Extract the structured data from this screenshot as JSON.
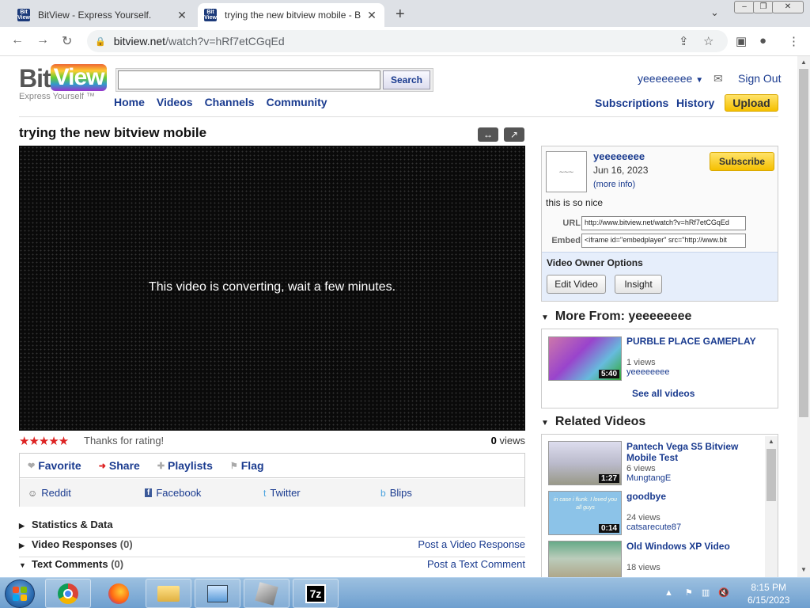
{
  "browser": {
    "tabs": [
      {
        "title": "BitView - Express Yourself.",
        "favicon": "Bit View"
      },
      {
        "title": "trying the new bitview mobile - B",
        "favicon": "Bit View"
      }
    ],
    "url_domain": "bitview.net",
    "url_path": "/watch?v=hRf7etCGqEd"
  },
  "header": {
    "logo_bit": "Bit",
    "logo_view": "View",
    "tagline": "Express Yourself ™",
    "search_placeholder": "",
    "search_button": "Search",
    "nav": [
      "Home",
      "Videos",
      "Channels",
      "Community"
    ],
    "username": "yeeeeeeee",
    "sign_out": "Sign Out",
    "subscriptions": "Subscriptions",
    "history": "History",
    "upload": "Upload"
  },
  "video": {
    "title": "trying the new bitview mobile",
    "player_message": "This video is converting, wait a few minutes.",
    "stars": "★★★★★",
    "rating_text": "Thanks for rating!",
    "view_count": "0",
    "views_label": "views",
    "actions": [
      "Favorite",
      "Share",
      "Playlists",
      "Flag"
    ],
    "share_targets": [
      "Reddit",
      "Facebook",
      "Twitter",
      "Blips"
    ]
  },
  "sections": {
    "stats": "Statistics & Data",
    "responses": "Video Responses",
    "responses_count": "(0)",
    "post_response": "Post a Video Response",
    "comments": "Text Comments",
    "comments_count": "(0)",
    "post_comment": "Post a Text Comment"
  },
  "channel": {
    "name": "yeeeeeeee",
    "date": "Jun 16, 2023",
    "more_info": "(more info)",
    "subscribe": "Subscribe",
    "description": "this is so nice",
    "url_label": "URL",
    "url_value": "http://www.bitview.net/watch?v=hRf7etCGqEd",
    "embed_label": "Embed",
    "embed_value": "<iframe id=\"embedplayer\" src=\"http://www.bit",
    "owner_options": "Video Owner Options",
    "edit_video": "Edit Video",
    "insight": "Insight"
  },
  "more_from": {
    "heading": "More From: yeeeeeeee",
    "video_title": "PURBLE PLACE GAMEPLAY",
    "duration": "5:40",
    "views": "1 views",
    "user": "yeeeeeeee",
    "see_all": "See all videos"
  },
  "related": {
    "heading": "Related Videos",
    "items": [
      {
        "title": "Pantech Vega S5 Bitview Mobile Test",
        "views": "6 views",
        "user": "MungtangE",
        "duration": "1:27"
      },
      {
        "title": "goodbye",
        "views": "24 views",
        "user": "catsarecute87",
        "duration": "0:14",
        "thumb_text": "in case i flunk. I loved you all guys"
      },
      {
        "title": "Old Windows XP Video",
        "views": "18 views",
        "user": "",
        "duration": ""
      }
    ]
  },
  "taskbar": {
    "time": "8:15 PM",
    "date": "6/15/2023",
    "app_7z": "7z"
  },
  "colors": {
    "accent": "#1a3b8f",
    "upload_yellow": "#f5c000",
    "star_red": "#dd2222"
  }
}
